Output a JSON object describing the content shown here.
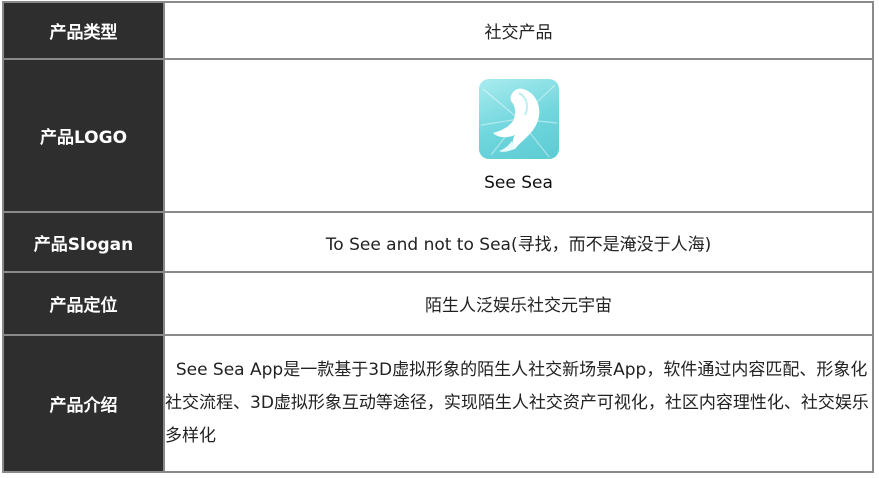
{
  "rows": {
    "type": {
      "label": "产品类型",
      "value": "社交产品"
    },
    "logo": {
      "label": "产品LOGO",
      "app_name": "See Sea",
      "icon": "whale-logo-icon",
      "tile_color": "#6fd6dd"
    },
    "slogan": {
      "label": "产品Slogan",
      "value": "To See and not to Sea(寻找，而不是淹没于人海)"
    },
    "position": {
      "label": "产品定位",
      "value": "陌生人泛娱乐社交元宇宙"
    },
    "intro": {
      "label": "产品介绍",
      "value": "  See Sea App是一款基于3D虚拟形象的陌生人社交新场景App，软件通过内容匹配、形象化社交流程、3D虚拟形象互动等途径，实现陌生人社交资产可视化，社区内容理性化、社交娱乐多样化"
    }
  },
  "colors": {
    "label_bg": "#2e2e2e",
    "border": "#8a8a8a"
  }
}
